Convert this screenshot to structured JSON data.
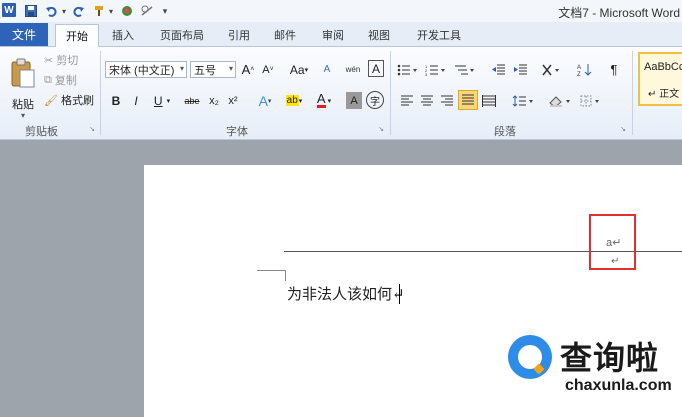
{
  "window": {
    "title": "文档7 - Microsoft Word"
  },
  "quick_access": {
    "word_icon": "W",
    "save_icon": "save-icon",
    "undo_icon": "undo-icon",
    "redo_icon": "redo-icon"
  },
  "tabs": [
    {
      "label": "文件"
    },
    {
      "label": "开始"
    },
    {
      "label": "插入"
    },
    {
      "label": "页面布局"
    },
    {
      "label": "引用"
    },
    {
      "label": "邮件"
    },
    {
      "label": "审阅"
    },
    {
      "label": "视图"
    },
    {
      "label": "开发工具"
    }
  ],
  "ribbon": {
    "clipboard": {
      "paste": "粘贴",
      "cut": "剪切",
      "copy": "复制",
      "format_painter": "格式刷",
      "group": "剪贴板"
    },
    "font": {
      "font_name": "宋体 (中文正)",
      "font_size": "五号",
      "grow": "A",
      "shrink": "A",
      "change_case": "Aa",
      "bold": "B",
      "italic": "I",
      "underline": "U",
      "strike": "abe",
      "subscript": "x₂",
      "superscript": "x²",
      "text_effect": "A",
      "highlight": "ab",
      "font_color": "A",
      "char_shading": "A",
      "enclose": "字",
      "phonetic": "wén",
      "char_border": "A",
      "clear_format": "A",
      "group": "字体"
    },
    "paragraph": {
      "group": "段落"
    },
    "styles": {
      "preview": "AaBbCc",
      "name": "↵ 正文"
    }
  },
  "document": {
    "header_mark": "a↵",
    "para_mark": "↵",
    "body_text": "为非法人该如何↵"
  },
  "watermark": {
    "brand": "查询啦",
    "url": "chaxunla.com"
  },
  "colors": {
    "file_tab": "#2d64b8",
    "red_highlight": "#e03030",
    "canvas": "#9ea4ac"
  }
}
